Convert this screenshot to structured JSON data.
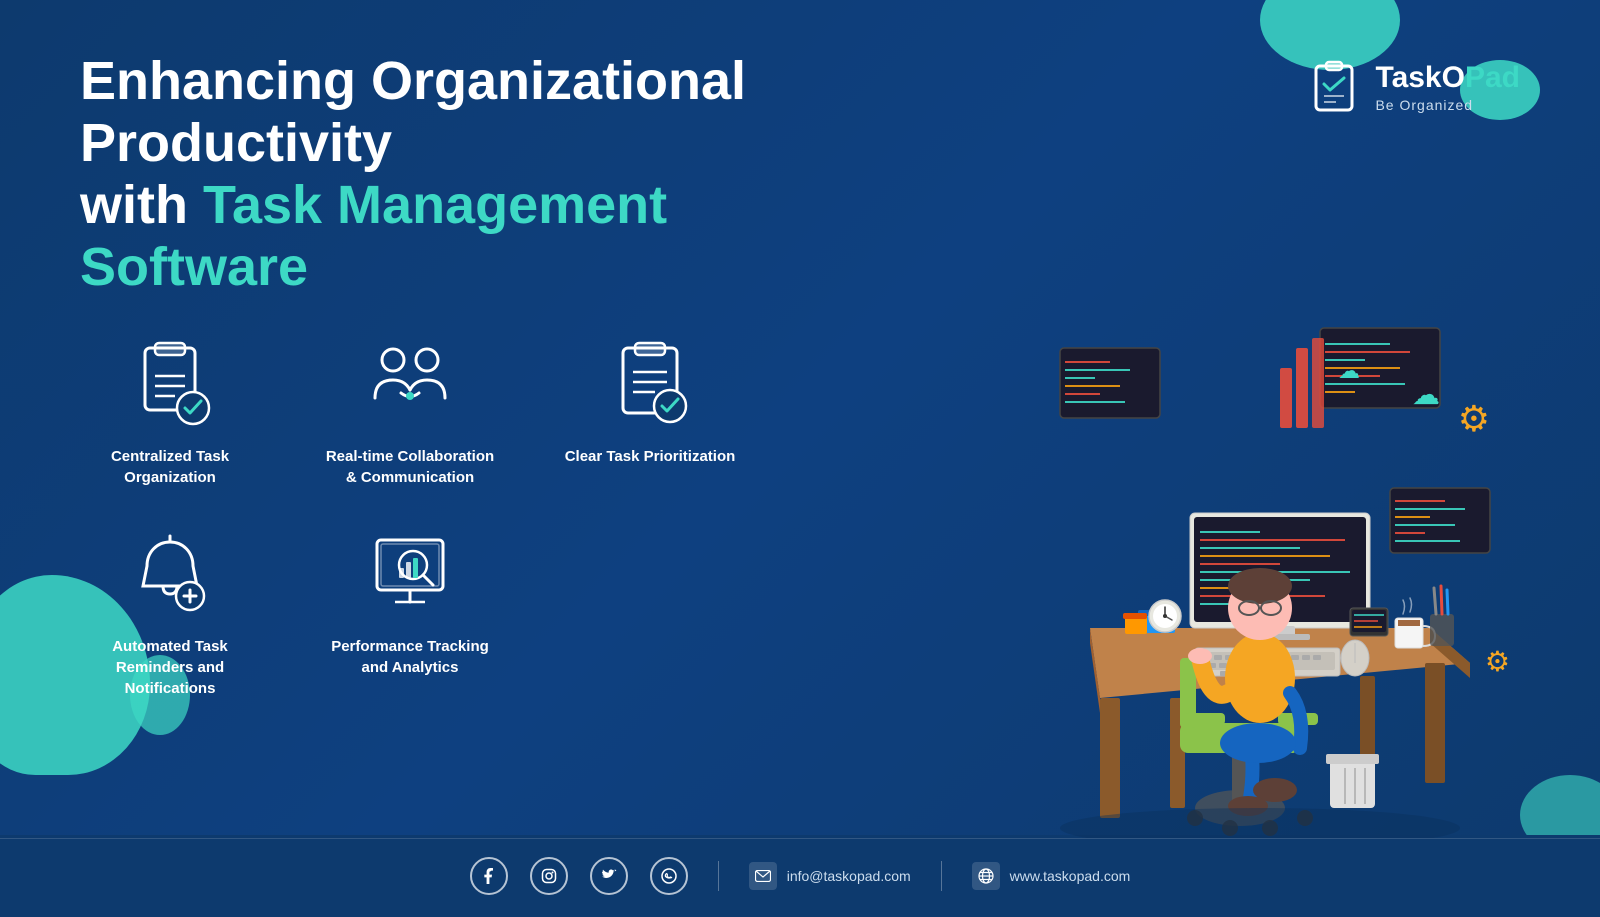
{
  "brand": {
    "name_part1": "TaskO",
    "name_part2": "Pad",
    "tagline": "Be Organized",
    "logo_alt": "TaskOPad logo"
  },
  "headline": {
    "line1": "Enhancing Organizational Productivity",
    "line2_plain": "with ",
    "line2_accent": "Task Management Software"
  },
  "features": {
    "row1": [
      {
        "id": "centralized-task",
        "label": "Centralized Task Organization"
      },
      {
        "id": "realtime-collab",
        "label": "Real-time Collaboration & Communication"
      },
      {
        "id": "clear-priority",
        "label": "Clear Task Prioritization"
      }
    ],
    "row2": [
      {
        "id": "automated-reminders",
        "label": "Automated Task Reminders and Notifications"
      },
      {
        "id": "performance-tracking",
        "label": "Performance Tracking and Analytics"
      }
    ]
  },
  "footer": {
    "email": "info@taskopad.com",
    "website": "www.taskopad.com",
    "social": [
      "facebook",
      "instagram",
      "twitter",
      "whatsapp"
    ]
  }
}
